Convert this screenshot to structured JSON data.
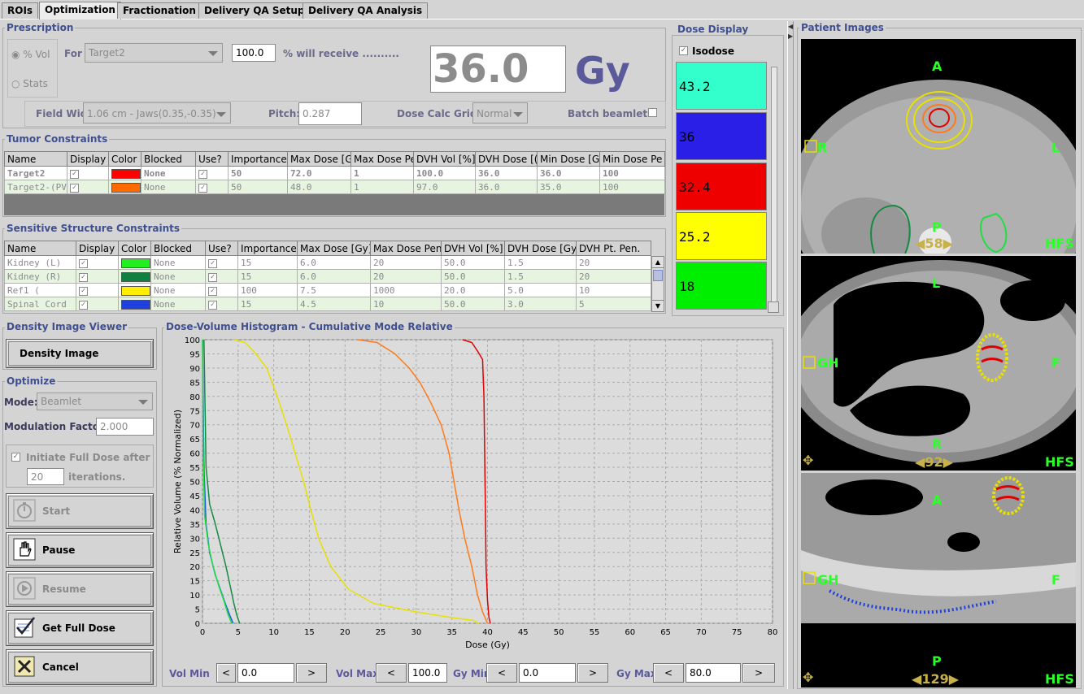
{
  "tabs": [
    {
      "label": "ROIs"
    },
    {
      "label": "Optimization"
    },
    {
      "label": "Fractionation"
    },
    {
      "label": "Delivery QA Setup"
    },
    {
      "label": "Delivery QA Analysis"
    }
  ],
  "prescription": {
    "title": "Prescription",
    "radio_vol": "% Vol",
    "radio_stats": "Stats",
    "for_label": "For",
    "target": "Target2",
    "percent": "100.0",
    "will_receive": "% will receive ..........",
    "dose": "36.0",
    "unit": "Gy",
    "field_width_label": "Field Width:",
    "field_width": "1.06 cm - Jaws(0.35,-0.35)",
    "pitch_label": "Pitch:",
    "pitch": "0.287",
    "dose_calc_label": "Dose Calc Grid:",
    "dose_calc": "Normal",
    "batch_label": "Batch beamlets"
  },
  "tumor": {
    "title": "Tumor Constraints",
    "headers": [
      "Name",
      "Display",
      "Color",
      "Blocked",
      "Use?",
      "Importance",
      "Max Dose [G",
      "Max Dose Pe",
      "DVH Vol [%]",
      "DVH Dose [(",
      "Min Dose [G",
      "Min Dose Pe"
    ],
    "rows": [
      {
        "name": "Target2",
        "color": "#ff0000",
        "blocked": "None",
        "importance": "50",
        "max_dose": "72.0",
        "max_pen": "1",
        "dvh_vol": "100.0",
        "dvh_dose": "36.0",
        "min_dose": "36.0",
        "min_pen": "100"
      },
      {
        "name": "Target2-(PV)",
        "color": "#ff6a00",
        "blocked": "None",
        "importance": "50",
        "max_dose": "48.0",
        "max_pen": "1",
        "dvh_vol": "97.0",
        "dvh_dose": "36.0",
        "min_dose": "35.0",
        "min_pen": "100"
      }
    ]
  },
  "sensitive": {
    "title": "Sensitive Structure Constraints",
    "headers": [
      "Name",
      "Display",
      "Color",
      "Blocked",
      "Use?",
      "Importance",
      "Max Dose [Gy]",
      "Max Dose Pen",
      "DVH Vol [%]",
      "DVH Dose [Gy",
      "DVH Pt. Pen."
    ],
    "rows": [
      {
        "name": "Kidney (L)",
        "color": "#22ee22",
        "blocked": "None",
        "importance": "15",
        "max_dose": "6.0",
        "max_pen": "20",
        "dvh_vol": "50.0",
        "dvh_dose": "1.5",
        "dvh_pen": "20"
      },
      {
        "name": "Kidney (R)",
        "color": "#108040",
        "blocked": "None",
        "importance": "15",
        "max_dose": "6.0",
        "max_pen": "20",
        "dvh_vol": "50.0",
        "dvh_dose": "1.5",
        "dvh_pen": "20"
      },
      {
        "name": "Ref1 (",
        "color": "#ffee00",
        "blocked": "None",
        "importance": "100",
        "max_dose": "7.5",
        "max_pen": "1000",
        "dvh_vol": "20.0",
        "dvh_dose": "5.0",
        "dvh_pen": "10"
      },
      {
        "name": "Spinal Cord",
        "color": "#2040dd",
        "blocked": "None",
        "importance": "15",
        "max_dose": "4.5",
        "max_pen": "10",
        "dvh_vol": "50.0",
        "dvh_dose": "3.0",
        "dvh_pen": "5"
      }
    ]
  },
  "dose_display": {
    "title": "Dose Display",
    "isodose_label": "Isodose",
    "levels": [
      {
        "value": "43.2",
        "color": "#33ffcc"
      },
      {
        "value": "36",
        "color": "#2a1fe6"
      },
      {
        "value": "32.4",
        "color": "#ee0000"
      },
      {
        "value": "25.2",
        "color": "#ffff00"
      },
      {
        "value": "18",
        "color": "#00ee00"
      }
    ]
  },
  "density": {
    "title": "Density Image Viewer",
    "button": "Density Image"
  },
  "optimize": {
    "title": "Optimize",
    "mode_label": "Mode:",
    "mode": "Beamlet",
    "mod_label": "Modulation Factor:",
    "mod_value": "2.000",
    "initiate_label": "Initiate Full Dose after",
    "iterations": "20",
    "iterations_label": "iterations.",
    "start": "Start",
    "pause": "Pause",
    "resume": "Resume",
    "get_full": "Get Full Dose",
    "cancel": "Cancel"
  },
  "dvh_title": "Dose-Volume Histogram - Cumulative Mode Relative",
  "chart_data": {
    "type": "line",
    "title": "",
    "xlabel": "Dose (Gy)",
    "ylabel": "Relative Volume (% Normalized)",
    "xlim": [
      0,
      80
    ],
    "ylim": [
      0,
      100
    ],
    "xticks": [
      0,
      5,
      10,
      15,
      20,
      25,
      30,
      35,
      40,
      45,
      50,
      55,
      60,
      65,
      70,
      75,
      80
    ],
    "yticks": [
      0,
      5,
      10,
      15,
      20,
      25,
      30,
      35,
      40,
      45,
      50,
      55,
      60,
      65,
      70,
      75,
      80,
      85,
      90,
      95,
      100
    ],
    "grid": true,
    "series": [
      {
        "color": "#e00000",
        "x": [
          36.5,
          37.8,
          38.6,
          39.3,
          39.5,
          39.6,
          39.7,
          39.8,
          40.0,
          40.2,
          40.4
        ],
        "y": [
          100,
          99,
          96,
          93,
          80,
          60,
          40,
          20,
          8,
          2,
          0
        ]
      },
      {
        "color": "#ff7a1a",
        "x": [
          21.8,
          24.5,
          27.0,
          29.0,
          30.5,
          32.0,
          33.5,
          34.6,
          35.3,
          36.0,
          36.8,
          37.8,
          38.6,
          39.3,
          40.0
        ],
        "y": [
          100,
          99,
          95,
          90,
          85,
          78,
          70,
          60,
          50,
          40,
          30,
          20,
          10,
          4,
          0
        ]
      },
      {
        "color": "#e8e000",
        "x": [
          4.5,
          6.0,
          7.5,
          9.0,
          10.5,
          11.8,
          13.0,
          14.2,
          15.2,
          16.3,
          18.0,
          20.5,
          24.0,
          30.0,
          35.0,
          38.0,
          38.8
        ],
        "y": [
          100,
          99,
          95,
          90,
          80,
          70,
          60,
          50,
          40,
          30,
          20,
          12,
          7,
          4,
          2,
          1,
          0
        ]
      },
      {
        "color": "#158a40",
        "x": [
          0.2,
          0.5,
          1.0,
          1.8,
          2.6,
          3.3,
          3.9,
          4.4,
          4.8,
          5.2
        ],
        "y": [
          100,
          55,
          42,
          35,
          27,
          20,
          13,
          7,
          3,
          0
        ]
      },
      {
        "color": "#1a5ae0",
        "x": [
          0.0,
          0.2,
          0.5,
          1.0,
          1.8,
          2.5,
          3.2,
          3.8,
          4.3
        ],
        "y": [
          100,
          55,
          35,
          25,
          17,
          12,
          7,
          3,
          0
        ]
      },
      {
        "color": "#22dd44",
        "x": [
          0.0,
          0.1,
          0.3,
          0.8,
          1.5,
          2.3,
          3.0,
          3.6,
          4.1
        ],
        "y": [
          100,
          60,
          38,
          28,
          20,
          13,
          8,
          3,
          0
        ]
      }
    ]
  },
  "axis_controls": {
    "vol_min_label": "Vol Min",
    "vol_min": "0.0",
    "vol_max_label": "Vol Max",
    "vol_max": "100.0",
    "gy_min_label": "Gy Min",
    "gy_min": "0.0",
    "gy_max_label": "Gy Max",
    "gy_max": "80.0",
    "left": "<",
    "right": ">"
  },
  "patient_images": {
    "title": "Patient Images",
    "axial": {
      "top": "A",
      "left": "R",
      "right": "L",
      "bottom": "P",
      "orient": "HFS",
      "slice": "58"
    },
    "coronal": {
      "top": "L",
      "left": "GH",
      "right": "F",
      "bottom": "R",
      "orient": "HFS",
      "slice": "92"
    },
    "sagittal": {
      "top": "A",
      "left": "GH",
      "right": "F",
      "bottom": "P",
      "orient": "HFS",
      "slice": "129"
    }
  }
}
